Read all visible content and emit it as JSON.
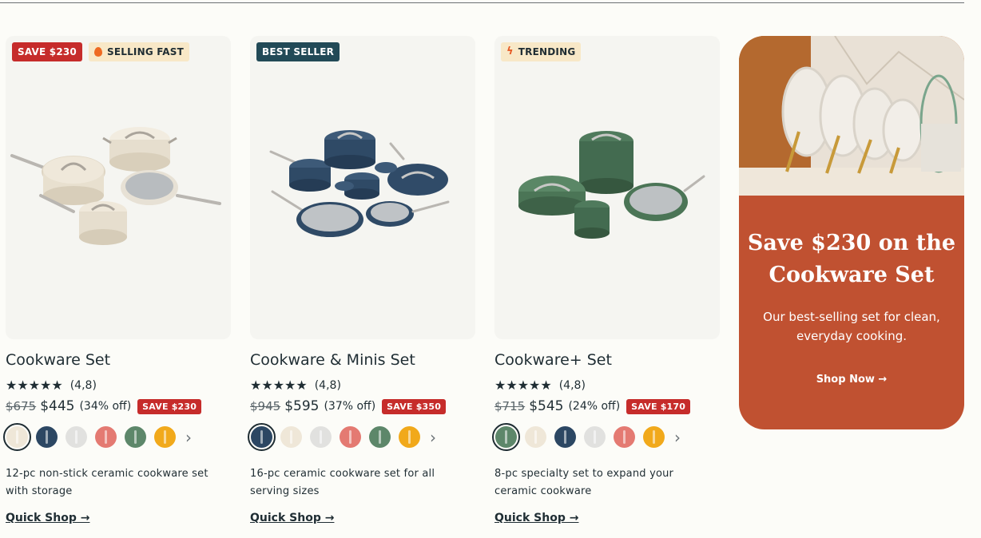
{
  "cards": [
    {
      "badges": [
        {
          "text": "SAVE $230",
          "style": "red"
        },
        {
          "text": "SELLING FAST",
          "style": "cream",
          "icon": "flame-icon"
        }
      ],
      "title": "Cookware Set",
      "rating": "(4,8)",
      "old_price": "$675",
      "price": "$445",
      "off": "(34% off)",
      "save": "SAVE $230",
      "desc": "12-pc non-stick ceramic cookware set with storage",
      "quick": "Quick Shop →",
      "swatches": [
        "#efe7d8",
        "#2c4763",
        "#e1e1df",
        "#e47a72",
        "#5d876a",
        "#f1a91b"
      ],
      "product_color": "cream"
    },
    {
      "badges": [
        {
          "text": "BEST SELLER",
          "style": "teal"
        }
      ],
      "title": "Cookware & Minis Set",
      "rating": "(4,8)",
      "old_price": "$945",
      "price": "$595",
      "off": "(37% off)",
      "save": "SAVE $350",
      "desc": "16-pc ceramic cookware set for all serving sizes",
      "quick": "Quick Shop →",
      "swatches": [
        "#2c4763",
        "#efe7d8",
        "#e1e1df",
        "#e47a72",
        "#5d876a",
        "#f1a91b"
      ],
      "product_color": "navy"
    },
    {
      "badges": [
        {
          "text": "TRENDING",
          "style": "cream",
          "icon": "lightning-icon"
        }
      ],
      "title": "Cookware+ Set",
      "rating": "(4,8)",
      "old_price": "$715",
      "price": "$545",
      "off": "(24% off)",
      "save": "SAVE $170",
      "desc": "8-pc specialty set to expand your ceramic cookware",
      "quick": "Quick Shop →",
      "swatches": [
        "#5d876a",
        "#efe7d8",
        "#2c4763",
        "#e1e1df",
        "#e47a72",
        "#f1a91b"
      ],
      "product_color": "green"
    }
  ],
  "promo": {
    "title": "Save $230 on the Cookware Set",
    "subtitle": "Our best-selling set for clean, everyday cooking.",
    "cta": "Shop Now →",
    "bg_color": "#c05131"
  },
  "stars": "★★★★★",
  "colors": {
    "accent_red": "#c62c2b",
    "teal": "#224a57",
    "ink": "#1f2d33"
  }
}
